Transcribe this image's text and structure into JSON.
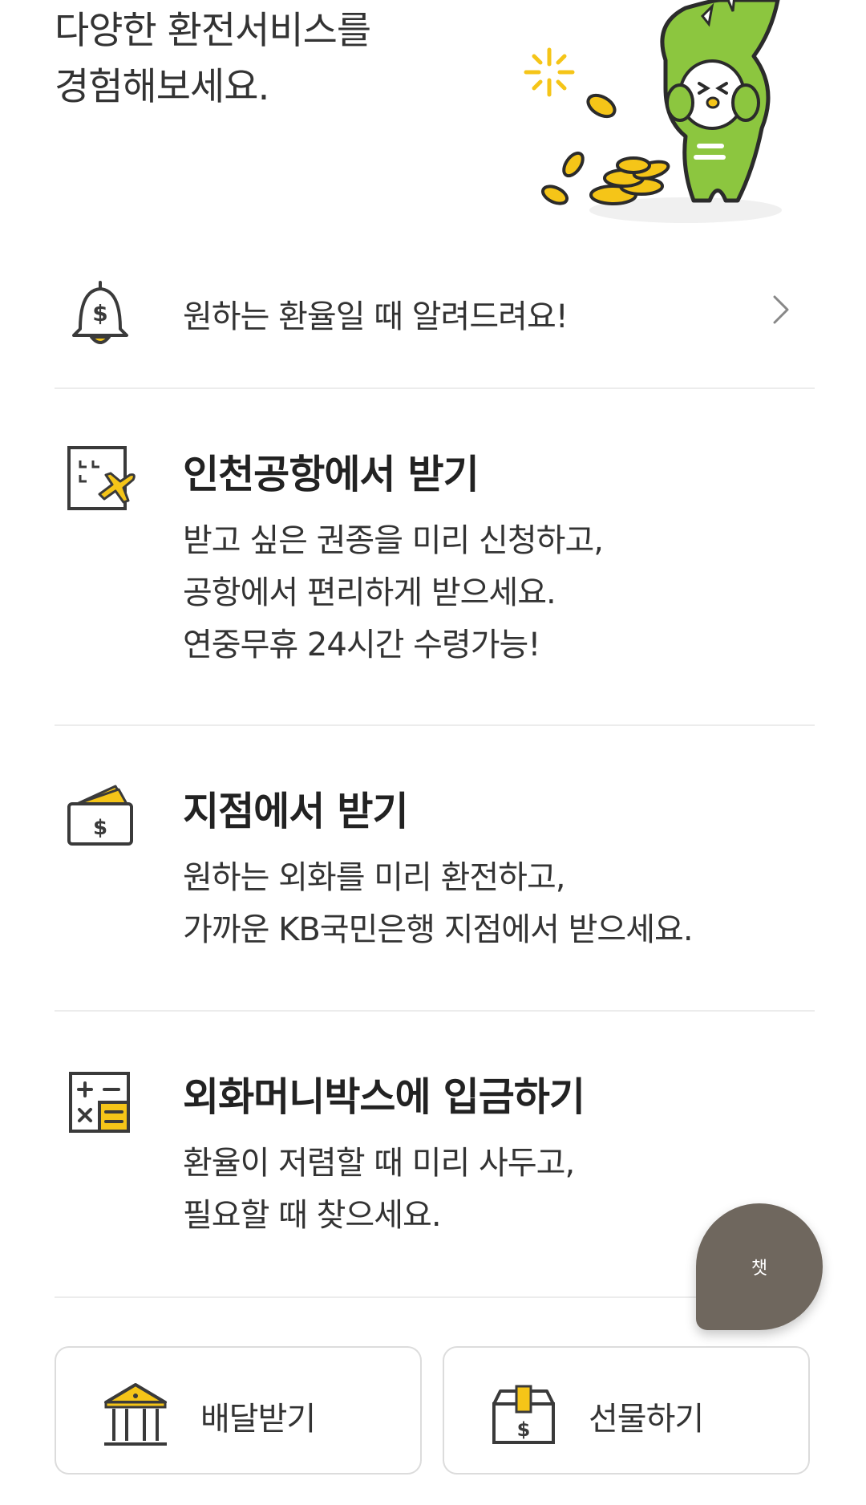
{
  "hero": {
    "title_line1": "다양한 환전서비스를",
    "title_line2": "경험해보세요."
  },
  "alert": {
    "label": "원하는 환율일 때 알려드려요!",
    "icon": "bell-dollar-icon"
  },
  "services": [
    {
      "title": "인천공항에서 받기",
      "icon": "airport-departure-icon",
      "desc": [
        "받고 싶은 권종을 미리 신청하고,",
        "공항에서 편리하게 받으세요.",
        "연중무휴 24시간 수령가능!"
      ]
    },
    {
      "title": "지점에서 받기",
      "icon": "wallet-dollar-icon",
      "desc": [
        "원하는 외화를 미리 환전하고,",
        "가까운 KB국민은행 지점에서 받으세요."
      ]
    },
    {
      "title": "외화머니박스에 입금하기",
      "icon": "calculator-icon",
      "desc": [
        "환율이 저렴할 때 미리 사두고,",
        "필요할 때 찾으세요."
      ]
    }
  ],
  "chat": {
    "label": "챗"
  },
  "bottom_buttons": [
    {
      "label": "배달받기",
      "icon": "bank-building-icon"
    },
    {
      "label": "선물하기",
      "icon": "gift-box-dollar-icon"
    }
  ],
  "colors": {
    "accent_yellow": "#f5c518",
    "mascot_green": "#8cc63f",
    "chat_bg": "#6f675e",
    "icon_stroke": "#3a3a3a"
  }
}
